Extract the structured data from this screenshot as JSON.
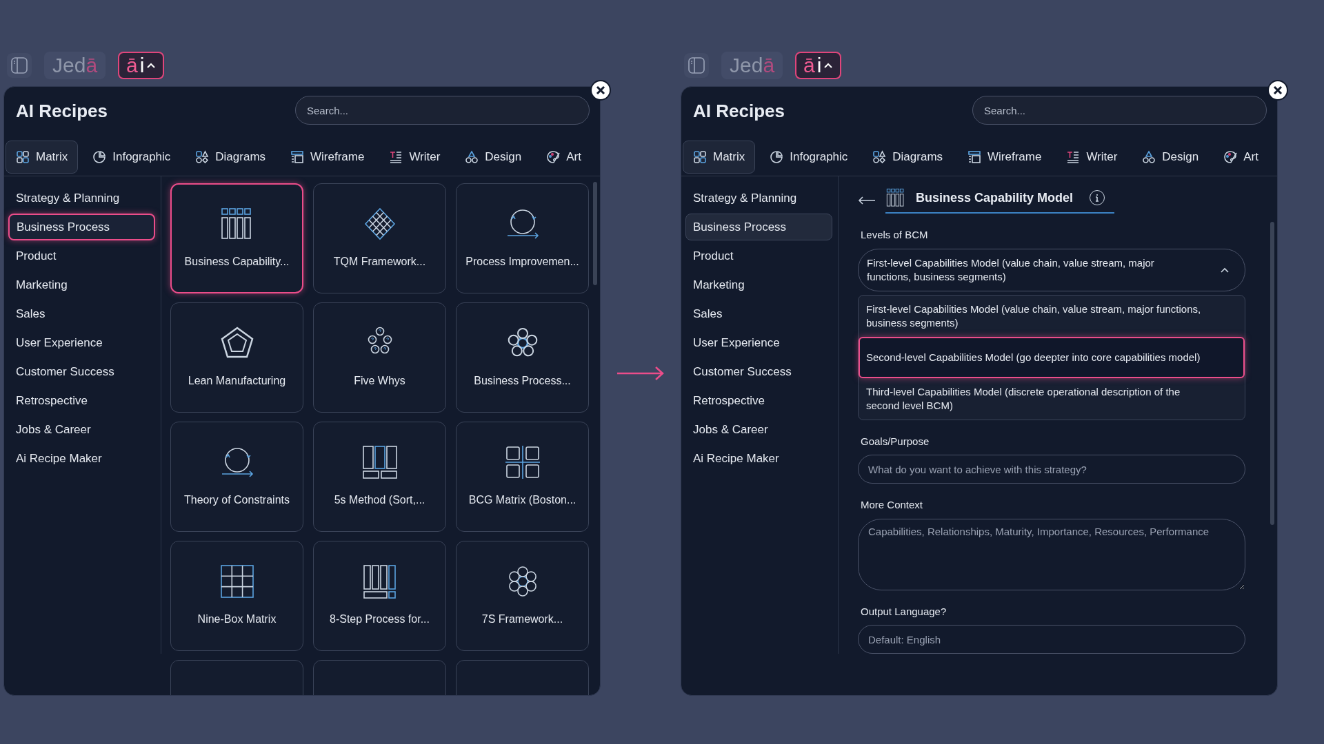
{
  "panels": [
    {
      "kind": "recipe_grid",
      "toolbar": {
        "brand": [
          "Jed",
          "ā"
        ],
        "ai_button": [
          "ā",
          "i"
        ]
      },
      "title": "AI Recipes",
      "search": {
        "placeholder": "Search..."
      },
      "tabs": [
        {
          "label": "Matrix",
          "selected": true
        },
        {
          "label": "Infographic",
          "selected": false
        },
        {
          "label": "Diagrams",
          "selected": false
        },
        {
          "label": "Wireframe",
          "selected": false
        },
        {
          "label": "Writer",
          "selected": false
        },
        {
          "label": "Design",
          "selected": false
        },
        {
          "label": "Art",
          "selected": false
        }
      ],
      "categories": [
        {
          "label": "Strategy & Planning",
          "selected": false
        },
        {
          "label": "Business Process",
          "selected": true
        },
        {
          "label": "Product",
          "selected": false
        },
        {
          "label": "Marketing",
          "selected": false
        },
        {
          "label": "Sales",
          "selected": false
        },
        {
          "label": "User Experience",
          "selected": false
        },
        {
          "label": "Customer Success",
          "selected": false
        },
        {
          "label": "Retrospective",
          "selected": false
        },
        {
          "label": "Jobs & Career",
          "selected": false
        },
        {
          "label": "Ai Recipe Maker",
          "selected": false
        }
      ],
      "recipes": [
        {
          "label": "Business Capability...",
          "selected": true
        },
        {
          "label": "TQM Framework...",
          "selected": false
        },
        {
          "label": "Process Improvemen...",
          "selected": false
        },
        {
          "label": "Lean Manufacturing",
          "selected": false
        },
        {
          "label": "Five Whys",
          "selected": false
        },
        {
          "label": "Business Process...",
          "selected": false
        },
        {
          "label": "Theory of Constraints",
          "selected": false
        },
        {
          "label": "5s Method (Sort,...",
          "selected": false
        },
        {
          "label": "BCG Matrix (Boston...",
          "selected": false
        },
        {
          "label": "Nine-Box Matrix",
          "selected": false
        },
        {
          "label": "8-Step Process for...",
          "selected": false
        },
        {
          "label": "7S Framework...",
          "selected": false
        }
      ]
    },
    {
      "kind": "recipe_form",
      "toolbar": {
        "brand": [
          "Jed",
          "ā"
        ],
        "ai_button": [
          "ā",
          "i"
        ]
      },
      "title": "AI Recipes",
      "search": {
        "placeholder": "Search..."
      },
      "tabs": [
        {
          "label": "Matrix",
          "selected": true
        },
        {
          "label": "Infographic",
          "selected": false
        },
        {
          "label": "Diagrams",
          "selected": false
        },
        {
          "label": "Wireframe",
          "selected": false
        },
        {
          "label": "Writer",
          "selected": false
        },
        {
          "label": "Design",
          "selected": false
        },
        {
          "label": "Art",
          "selected": false
        }
      ],
      "categories": [
        {
          "label": "Strategy & Planning",
          "selected": false
        },
        {
          "label": "Business Process",
          "selected": true
        },
        {
          "label": "Product",
          "selected": false
        },
        {
          "label": "Marketing",
          "selected": false
        },
        {
          "label": "Sales",
          "selected": false
        },
        {
          "label": "User Experience",
          "selected": false
        },
        {
          "label": "Customer Success",
          "selected": false
        },
        {
          "label": "Retrospective",
          "selected": false
        },
        {
          "label": "Jobs & Career",
          "selected": false
        },
        {
          "label": "Ai Recipe Maker",
          "selected": false
        }
      ],
      "recipe": {
        "title": "Business Capability Model"
      },
      "fields": [
        {
          "kind": "select",
          "label": "Levels of BCM",
          "value": "First-level Capabilities Model (value chain, value stream, major functions, business segments)",
          "expanded": true,
          "options": [
            {
              "text": "First-level Capabilities Model (value chain, value stream, major functions, business segments)",
              "highlighted": false
            },
            {
              "text": "Second-level Capabilities Model (go deepter into core capabilities model)",
              "highlighted": true
            },
            {
              "text": "Third-level Capabilities Model (discrete operational description of the second level BCM)",
              "highlighted": false
            }
          ]
        },
        {
          "kind": "text",
          "label": "Goals/Purpose",
          "placeholder": "What do you want to achieve with this strategy?"
        },
        {
          "kind": "textarea",
          "label": "More Context",
          "placeholder": "Capabilities, Relationships, Maturity, Importance, Resources, Performance"
        },
        {
          "kind": "text",
          "label": "Output Language?",
          "placeholder": "Default: English"
        }
      ]
    }
  ]
}
